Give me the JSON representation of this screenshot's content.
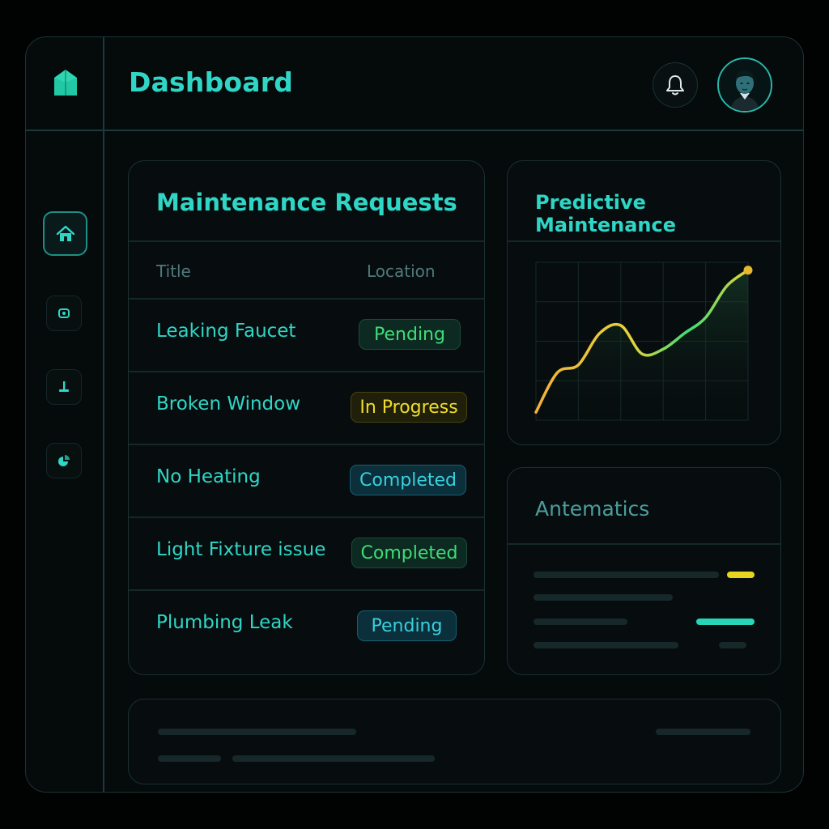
{
  "header": {
    "title": "Dashboard"
  },
  "icons": {
    "logo": "house-logo-icon",
    "bell": "bell-icon",
    "avatar": "user-avatar",
    "sidebar": [
      "home-icon",
      "camera-icon",
      "wrench-icon",
      "pie-chart-icon"
    ]
  },
  "maintenance": {
    "title": "Maintenance Requests",
    "columns": {
      "title": "Title",
      "location": "Location"
    },
    "rows": [
      {
        "title": "Leaking Faucet",
        "status": "Pending",
        "tone": "green"
      },
      {
        "title": "Broken Window",
        "status": "In Progress",
        "tone": "yellow"
      },
      {
        "title": "No Heating",
        "status": "Completed",
        "tone": "blue"
      },
      {
        "title": "Light Fixture issue",
        "status": "Completed",
        "tone": "green"
      },
      {
        "title": "Plumbing Leak",
        "status": "Pending",
        "tone": "blue"
      }
    ]
  },
  "predictive": {
    "title": "Predictive Maintenance"
  },
  "chart_data": {
    "type": "line",
    "title": "",
    "xlabel": "",
    "ylabel": "",
    "grid": true,
    "x": [
      0,
      1,
      2,
      3,
      4,
      5,
      6,
      7,
      8,
      9,
      10
    ],
    "series": [
      {
        "values": [
          0.5,
          3.0,
          3.5,
          5.5,
          6.0,
          4.2,
          4.5,
          5.5,
          6.5,
          8.5,
          9.5
        ]
      }
    ],
    "ylim": [
      0,
      10
    ],
    "colors": [
      "#f2b13a",
      "#e6d43a",
      "#3fdc77"
    ]
  },
  "antematics": {
    "title": "Antematics"
  },
  "colors": {
    "accent": "#2fd6c6",
    "pending": "#3fdc77",
    "in_progress": "#f0dc2e",
    "completed": "#38d0dc",
    "background": "#050a0b"
  }
}
